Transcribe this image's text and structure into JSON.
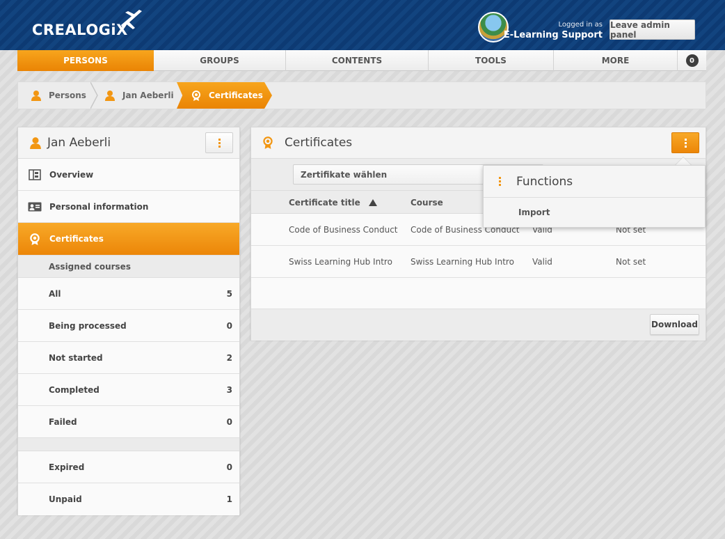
{
  "header": {
    "logo_text": "CREALOGiX",
    "logged_in_label": "Logged in as",
    "user_name": "E-Learning Support",
    "leave_button": "Leave admin panel"
  },
  "mainnav": {
    "items": [
      {
        "label": "PERSONS",
        "active": true
      },
      {
        "label": "GROUPS",
        "active": false
      },
      {
        "label": "CONTENTS",
        "active": false
      },
      {
        "label": "TOOLS",
        "active": false
      },
      {
        "label": "MORE",
        "active": false
      }
    ],
    "notification_count": "0"
  },
  "breadcrumb": {
    "items": [
      "Persons",
      "Jan Aeberli",
      "Certificates"
    ]
  },
  "left_panel": {
    "title": "Jan Aeberli",
    "menu": [
      {
        "label": "Overview",
        "icon": "layout-icon"
      },
      {
        "label": "Personal information",
        "icon": "id-card-icon"
      },
      {
        "label": "Certificates",
        "icon": "certificate-icon",
        "active": true
      }
    ],
    "section_title": "Assigned courses",
    "stats": [
      {
        "label": "All",
        "value": "5"
      },
      {
        "label": "Being processed",
        "value": "0"
      },
      {
        "label": "Not started",
        "value": "2"
      },
      {
        "label": "Completed",
        "value": "3"
      },
      {
        "label": "Failed",
        "value": "0"
      }
    ],
    "stats_extra": [
      {
        "label": "Expired",
        "value": "0"
      },
      {
        "label": "Unpaid",
        "value": "1"
      }
    ]
  },
  "right_panel": {
    "title": "Certificates",
    "select_value": "Zertifikate wählen",
    "columns": [
      "Certificate title",
      "Course"
    ],
    "rows": [
      {
        "title": "Code of Business Conduct",
        "course": "Code of Business Conduct",
        "status": "Valid",
        "expiry": "Not set"
      },
      {
        "title": "Swiss Learning Hub Intro",
        "course": "Swiss Learning Hub Intro",
        "status": "Valid",
        "expiry": "Not set"
      }
    ],
    "download_button": "Download"
  },
  "functions_popup": {
    "title": "Functions",
    "items": [
      "Import"
    ]
  },
  "colors": {
    "accent": "#f29612",
    "header_blue": "#0f3d79"
  }
}
